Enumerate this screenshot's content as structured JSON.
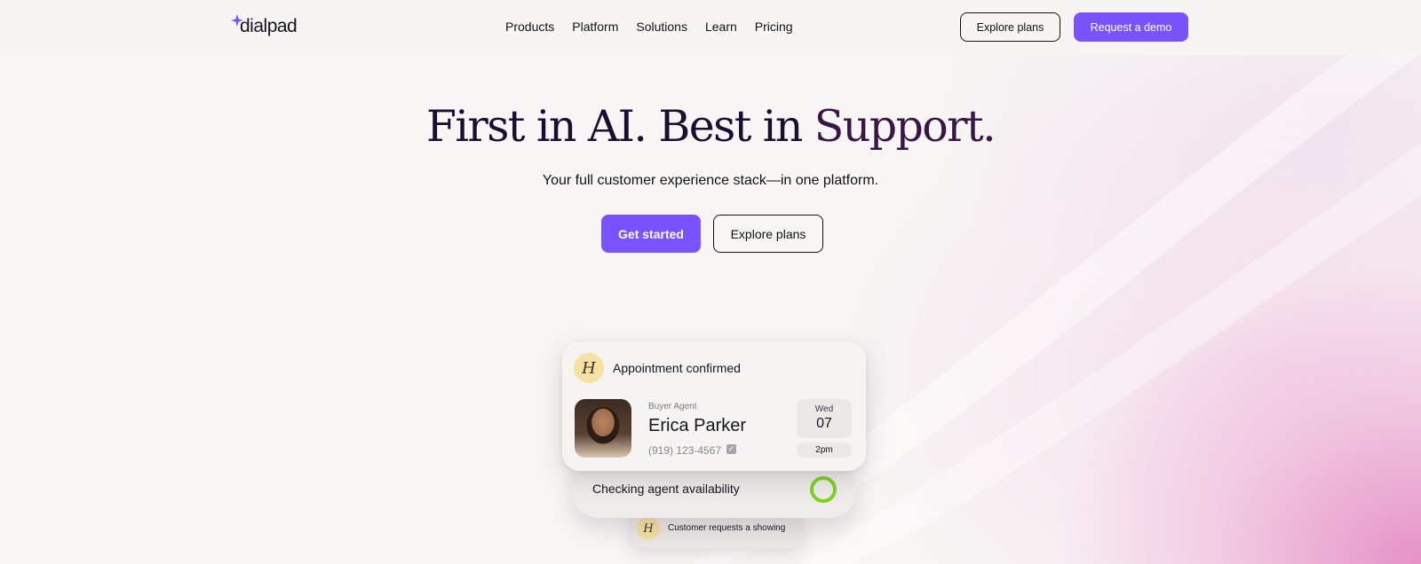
{
  "brand": {
    "name": "dialpad",
    "accent_color": "#7b52ff"
  },
  "nav": {
    "items": [
      {
        "label": "Products"
      },
      {
        "label": "Platform"
      },
      {
        "label": "Solutions"
      },
      {
        "label": "Learn"
      },
      {
        "label": "Pricing"
      }
    ],
    "explore_label": "Explore plans",
    "demo_label": "Request a demo"
  },
  "hero": {
    "title_main": "First in AI. Best in ",
    "title_accent": "Support.",
    "subtitle": "Your full customer experience stack—in one platform.",
    "cta_primary": "Get started",
    "cta_secondary": "Explore plans"
  },
  "appointment_card": {
    "badge": "H",
    "title": "Appointment confirmed",
    "role": "Buyer Agent",
    "name": "Erica Parker",
    "phone": "(919) 123-4567",
    "day": "Wed",
    "date": "07",
    "time": "2pm"
  },
  "status_card": {
    "label": "Checking agent availability",
    "spinner_color": "#7ed321"
  },
  "request_card": {
    "badge": "H",
    "label": "Customer requests a showing"
  }
}
